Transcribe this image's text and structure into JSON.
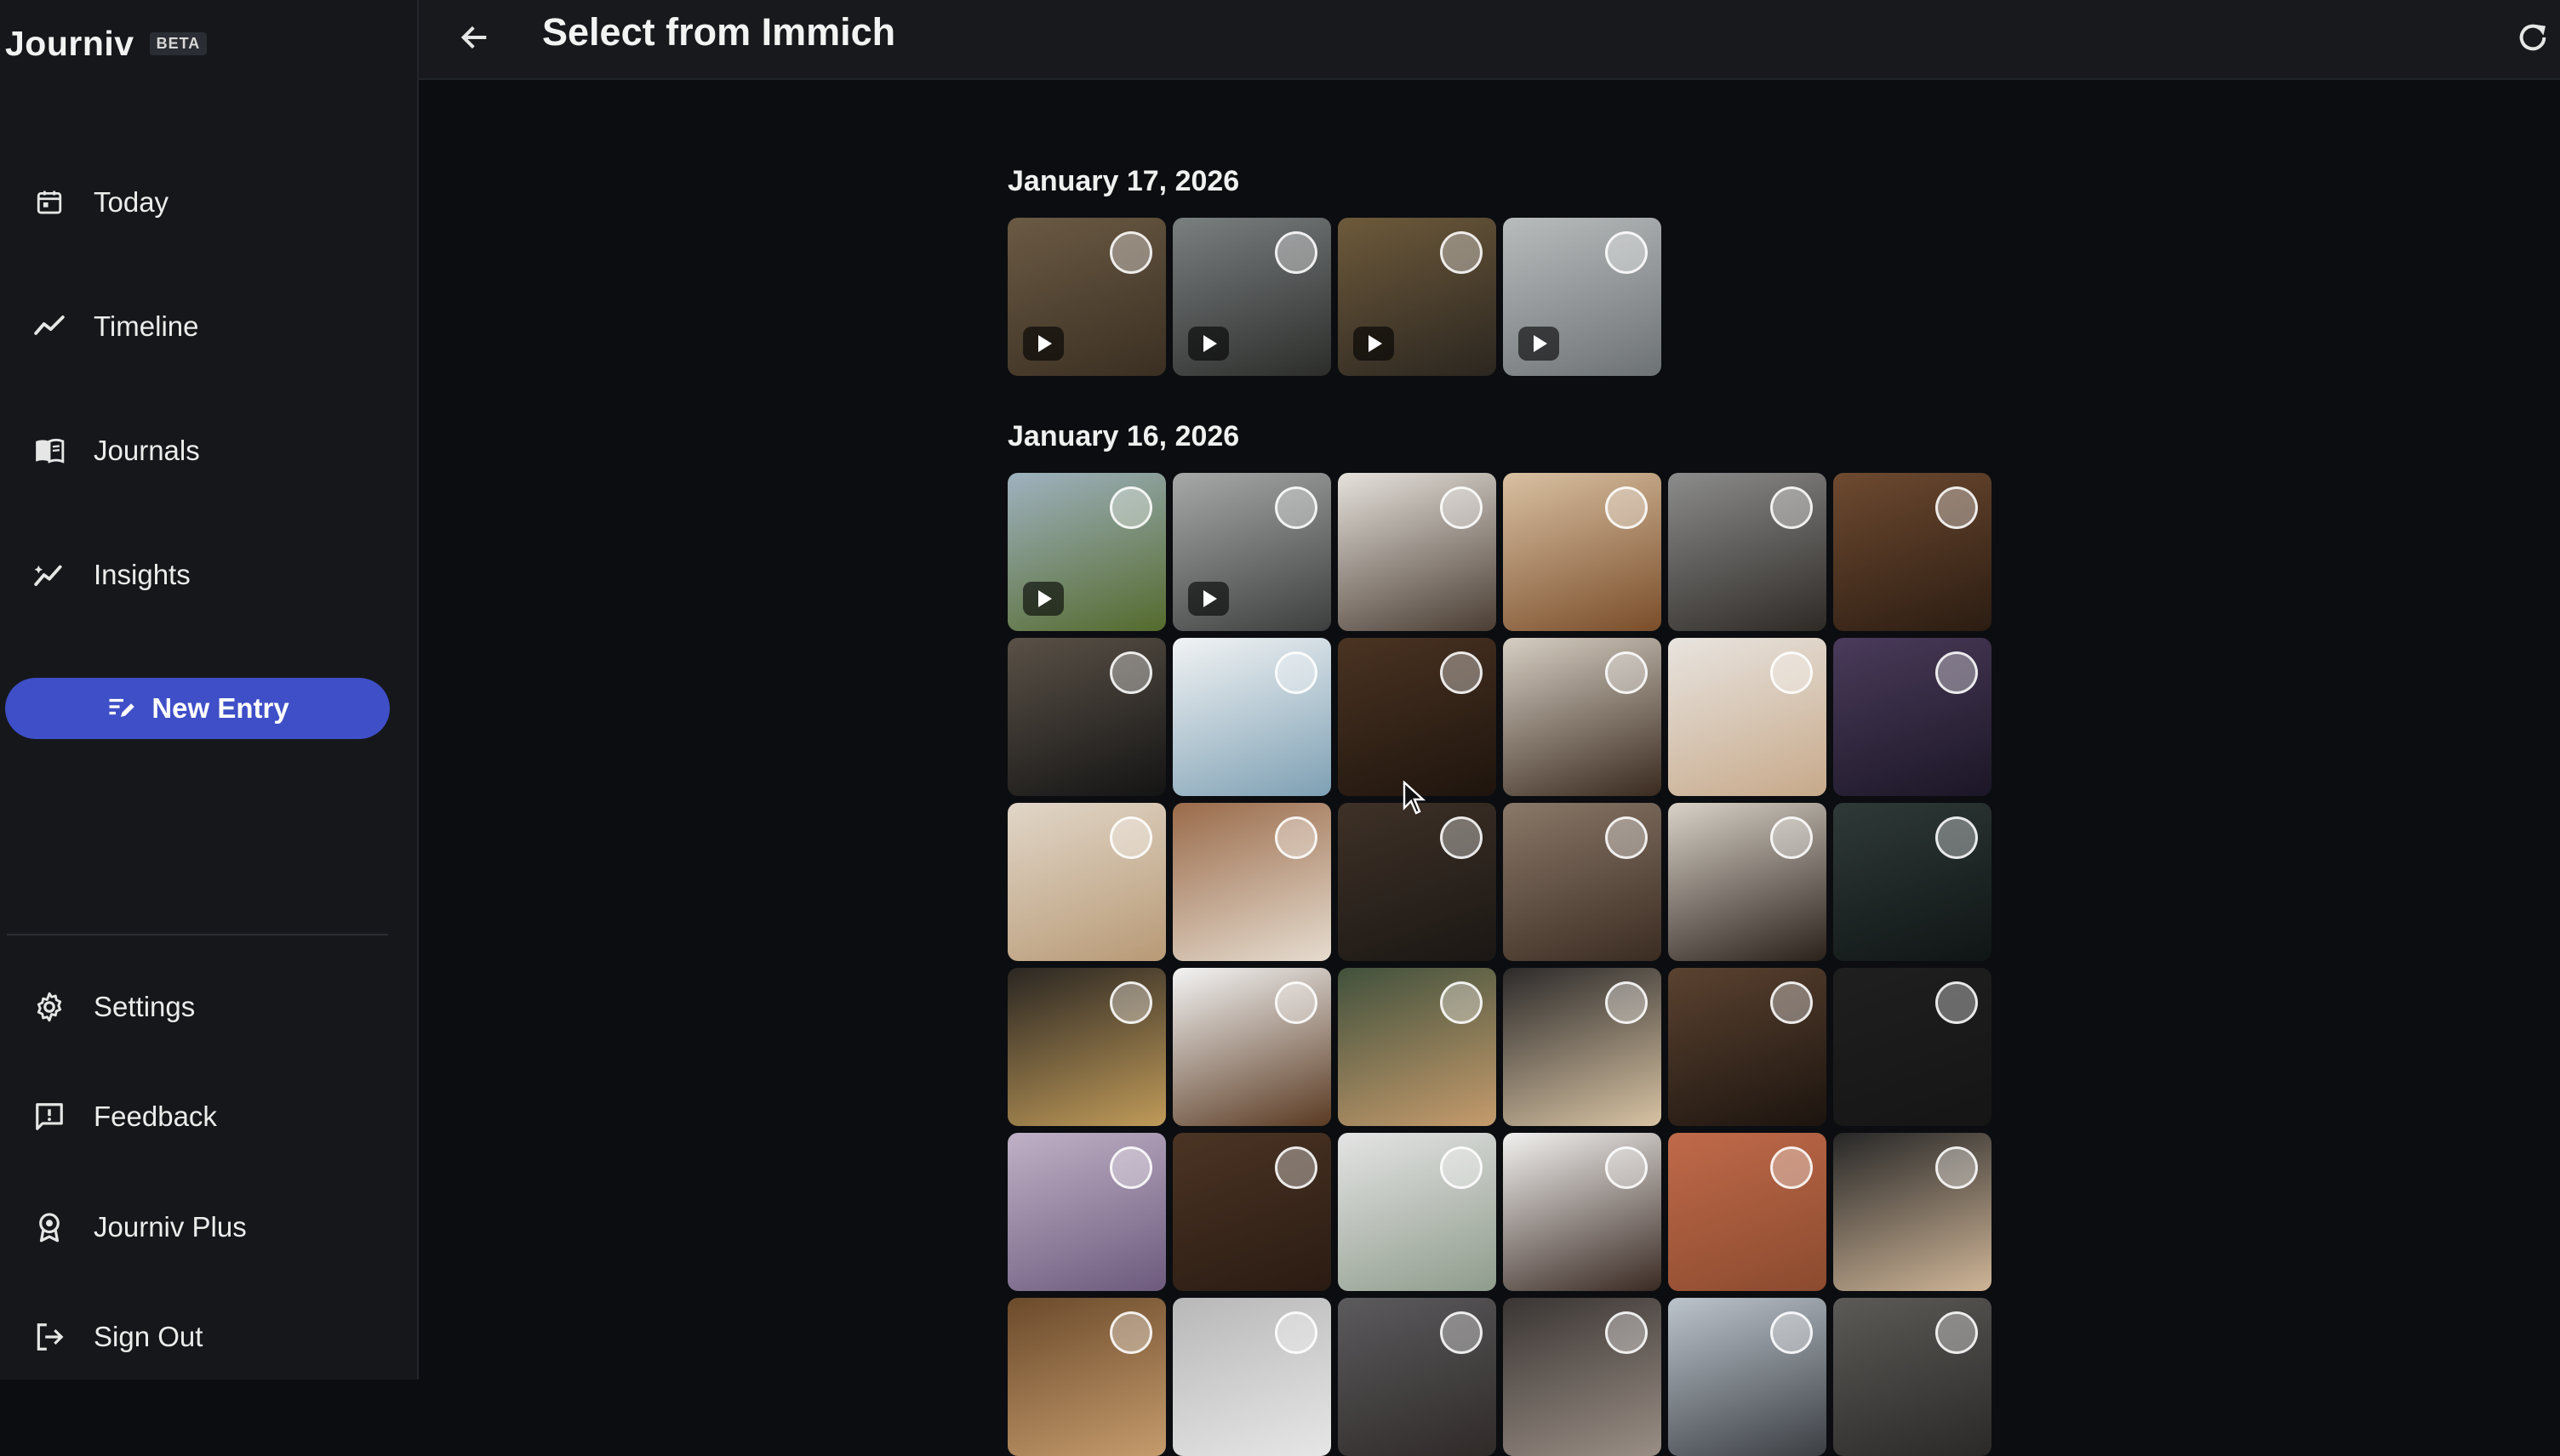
{
  "app": {
    "name": "Journiv",
    "badge": "BETA"
  },
  "sidebar": {
    "items": [
      {
        "label": "Today",
        "icon": "calendar-icon"
      },
      {
        "label": "Timeline",
        "icon": "trend-line-icon"
      },
      {
        "label": "Journals",
        "icon": "book-icon"
      },
      {
        "label": "Insights",
        "icon": "insights-icon"
      }
    ],
    "new_entry_label": "New Entry",
    "bottom_items": [
      {
        "label": "Settings",
        "icon": "gear-icon"
      },
      {
        "label": "Feedback",
        "icon": "feedback-icon"
      },
      {
        "label": "Journiv Plus",
        "icon": "badge-icon"
      },
      {
        "label": "Sign Out",
        "icon": "sign-out-icon"
      }
    ]
  },
  "header": {
    "title": "Select from Immich"
  },
  "groups": [
    {
      "date": "January 17, 2026",
      "tiles": [
        {
          "video": true,
          "colors": [
            "#6b5a44",
            "#3a2f22"
          ]
        },
        {
          "video": true,
          "colors": [
            "#7a7f80",
            "#2c2d2b"
          ]
        },
        {
          "video": true,
          "colors": [
            "#6e5a3b",
            "#2b2620"
          ]
        },
        {
          "video": true,
          "colors": [
            "#b8bcbd",
            "#6d7275"
          ]
        }
      ]
    },
    {
      "date": "January 16, 2026",
      "tiles": [
        {
          "video": true,
          "colors": [
            "#9fb2c0",
            "#546a2c"
          ]
        },
        {
          "video": true,
          "colors": [
            "#a7a9a8",
            "#3d3f3f"
          ]
        },
        {
          "video": false,
          "colors": [
            "#e6e2dc",
            "#4a3d33"
          ]
        },
        {
          "video": false,
          "colors": [
            "#d9c1a2",
            "#7a4d2a"
          ]
        },
        {
          "video": false,
          "colors": [
            "#8c8c8c",
            "#2e2a26"
          ]
        },
        {
          "video": false,
          "colors": [
            "#6e4a30",
            "#2b1c12"
          ]
        },
        {
          "video": false,
          "colors": [
            "#5a5147",
            "#141414"
          ]
        },
        {
          "video": false,
          "colors": [
            "#f1f3f4",
            "#7ea0b4"
          ]
        },
        {
          "video": false,
          "colors": [
            "#4a3322",
            "#1e140d"
          ]
        },
        {
          "video": false,
          "colors": [
            "#d7cfc3",
            "#3a2a1f"
          ]
        },
        {
          "video": false,
          "colors": [
            "#e8e4df",
            "#c7a98a"
          ]
        },
        {
          "video": false,
          "colors": [
            "#4a3b5a",
            "#1b1626"
          ]
        },
        {
          "video": false,
          "colors": [
            "#e1d6c8",
            "#b89a76"
          ]
        },
        {
          "video": false,
          "colors": [
            "#9a6b4a",
            "#e6dccf"
          ]
        },
        {
          "video": false,
          "colors": [
            "#3e3127",
            "#1b1714"
          ]
        },
        {
          "video": false,
          "colors": [
            "#8a7868",
            "#3b2c22"
          ]
        },
        {
          "video": false,
          "colors": [
            "#d9d2c8",
            "#2a211b"
          ]
        },
        {
          "video": false,
          "colors": [
            "#2f3a38",
            "#0f1514"
          ]
        },
        {
          "video": false,
          "colors": [
            "#2a2622",
            "#c09b59"
          ]
        },
        {
          "video": false,
          "colors": [
            "#f4f4f4",
            "#5a3a22"
          ]
        },
        {
          "video": false,
          "colors": [
            "#41513c",
            "#c59b6c"
          ]
        },
        {
          "video": false,
          "colors": [
            "#2c2a2a",
            "#d8c3a3"
          ]
        },
        {
          "video": false,
          "colors": [
            "#5b4230",
            "#1c140f"
          ]
        },
        {
          "video": false,
          "colors": [
            "#1f1f1f",
            "#151515"
          ]
        },
        {
          "video": false,
          "colors": [
            "#bfb1c6",
            "#6d5a7d"
          ]
        },
        {
          "video": false,
          "colors": [
            "#4b3424",
            "#2a1b12"
          ]
        },
        {
          "video": false,
          "colors": [
            "#e4e4e4",
            "#8f9c8c"
          ]
        },
        {
          "video": false,
          "colors": [
            "#f2f1ef",
            "#3a2a23"
          ]
        },
        {
          "video": false,
          "colors": [
            "#c06a4a",
            "#8b4a2e"
          ]
        },
        {
          "video": false,
          "colors": [
            "#272727",
            "#cfb597"
          ]
        },
        {
          "video": false,
          "colors": [
            "#6b4a2b",
            "#c59b6c"
          ]
        },
        {
          "video": false,
          "colors": [
            "#b8b8b8",
            "#e6e6e6"
          ]
        },
        {
          "video": false,
          "colors": [
            "#5b5a5d",
            "#2f2a28"
          ]
        },
        {
          "video": false,
          "colors": [
            "#3a3533",
            "#9a8e85"
          ]
        },
        {
          "video": false,
          "colors": [
            "#bcc4cc",
            "#3b3f44"
          ]
        },
        {
          "video": false,
          "colors": [
            "#5c5a57",
            "#2b2927"
          ]
        }
      ]
    }
  ]
}
